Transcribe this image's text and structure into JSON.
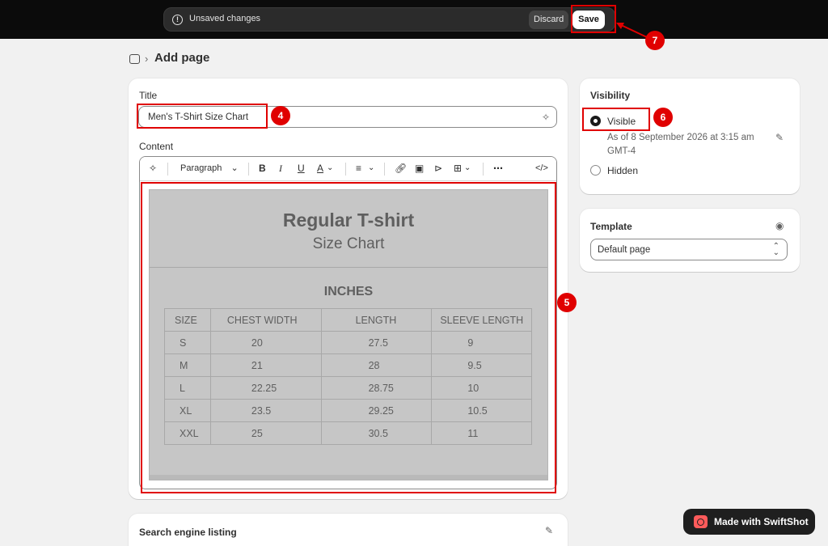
{
  "topbar": {
    "status": "Unsaved changes",
    "discard_label": "Discard",
    "save_label": "Save"
  },
  "header": {
    "title": "Add page"
  },
  "main": {
    "title_label": "Title",
    "title_value": "Men's T-Shirt Size Chart",
    "content_label": "Content",
    "paragraph_label": "Paragraph"
  },
  "size_chart": {
    "title": "Regular T-shirt",
    "subtitle": "Size Chart",
    "unit": "INCHES",
    "headers": [
      "SIZE",
      "CHEST WIDTH",
      "LENGTH",
      "SLEEVE LENGTH"
    ],
    "rows": [
      [
        "S",
        "20",
        "27.5",
        "9"
      ],
      [
        "M",
        "21",
        "28",
        "9.5"
      ],
      [
        "L",
        "22.25",
        "28.75",
        "10"
      ],
      [
        "XL",
        "23.5",
        "29.25",
        "10.5"
      ],
      [
        "XXL",
        "25",
        "30.5",
        "11"
      ]
    ]
  },
  "seo": {
    "title": "Search engine listing"
  },
  "visibility": {
    "title": "Visibility",
    "visible_label": "Visible",
    "visible_note": "As of 8 September 2026 at 3:15 am GMT-4",
    "hidden_label": "Hidden",
    "selected": "Visible"
  },
  "template": {
    "title": "Template",
    "selected": "Default page"
  },
  "annotations": {
    "b4": "4",
    "b5": "5",
    "b6": "6",
    "b7": "7",
    "color": "#e00000"
  },
  "watermark": {
    "label": "Made with SwiftShot"
  }
}
